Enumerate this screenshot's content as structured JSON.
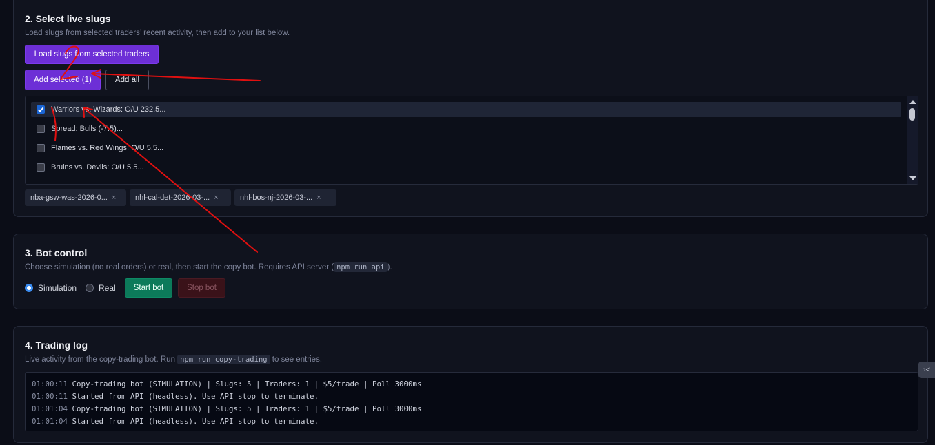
{
  "select_slugs": {
    "title": "2. Select live slugs",
    "description": "Load slugs from selected traders’ recent activity, then add to your list below.",
    "load_button": "Load slugs from selected traders",
    "add_selected_button": "Add selected (1)",
    "add_all_button": "Add all",
    "slugs": [
      {
        "label": "Warriors vs. Wizards: O/U 232.5...",
        "checked": true
      },
      {
        "label": "Spread: Bulls (-7.5)...",
        "checked": false
      },
      {
        "label": "Flames vs. Red Wings: O/U 5.5...",
        "checked": false
      },
      {
        "label": "Bruins vs. Devils: O/U 5.5...",
        "checked": false
      }
    ],
    "chips": [
      {
        "label": "nba-gsw-was-2026-0...",
        "remove": "×"
      },
      {
        "label": "nhl-cal-det-2026-03-...",
        "remove": "×"
      },
      {
        "label": "nhl-bos-nj-2026-03-...",
        "remove": "×"
      }
    ]
  },
  "bot_control": {
    "title": "3. Bot control",
    "description_before": "Choose simulation (no real orders) or real, then start the copy bot. Requires API server (",
    "description_code": "npm run api",
    "description_after": ").",
    "mode_simulation": "Simulation",
    "mode_real": "Real",
    "selected_mode": "Simulation",
    "start_button": "Start bot",
    "stop_button": "Stop bot"
  },
  "trading_log": {
    "title": "4. Trading log",
    "description_before": "Live activity from the copy-trading bot. Run ",
    "description_code": "npm run copy-trading",
    "description_after": " to see entries.",
    "entries": [
      {
        "time": "01:00:11",
        "message": "Copy-trading bot (SIMULATION) | Slugs: 5 | Traders: 1 | $5/trade | Poll 3000ms"
      },
      {
        "time": "01:00:11",
        "message": "Started from API (headless). Use API stop to terminate."
      },
      {
        "time": "01:01:04",
        "message": "Copy-trading bot (SIMULATION) | Slugs: 5 | Traders: 1 | $5/trade | Poll 3000ms"
      },
      {
        "time": "01:01:04",
        "message": "Started from API (headless). Use API stop to terminate."
      }
    ]
  },
  "side_handle": "›<",
  "colors": {
    "accent_purple": "#6d2fd6",
    "start_green": "#0c7a5a",
    "stop_red": "#3a1219",
    "annotation_red": "#e01010",
    "checkbox_blue": "#1b66d6"
  }
}
